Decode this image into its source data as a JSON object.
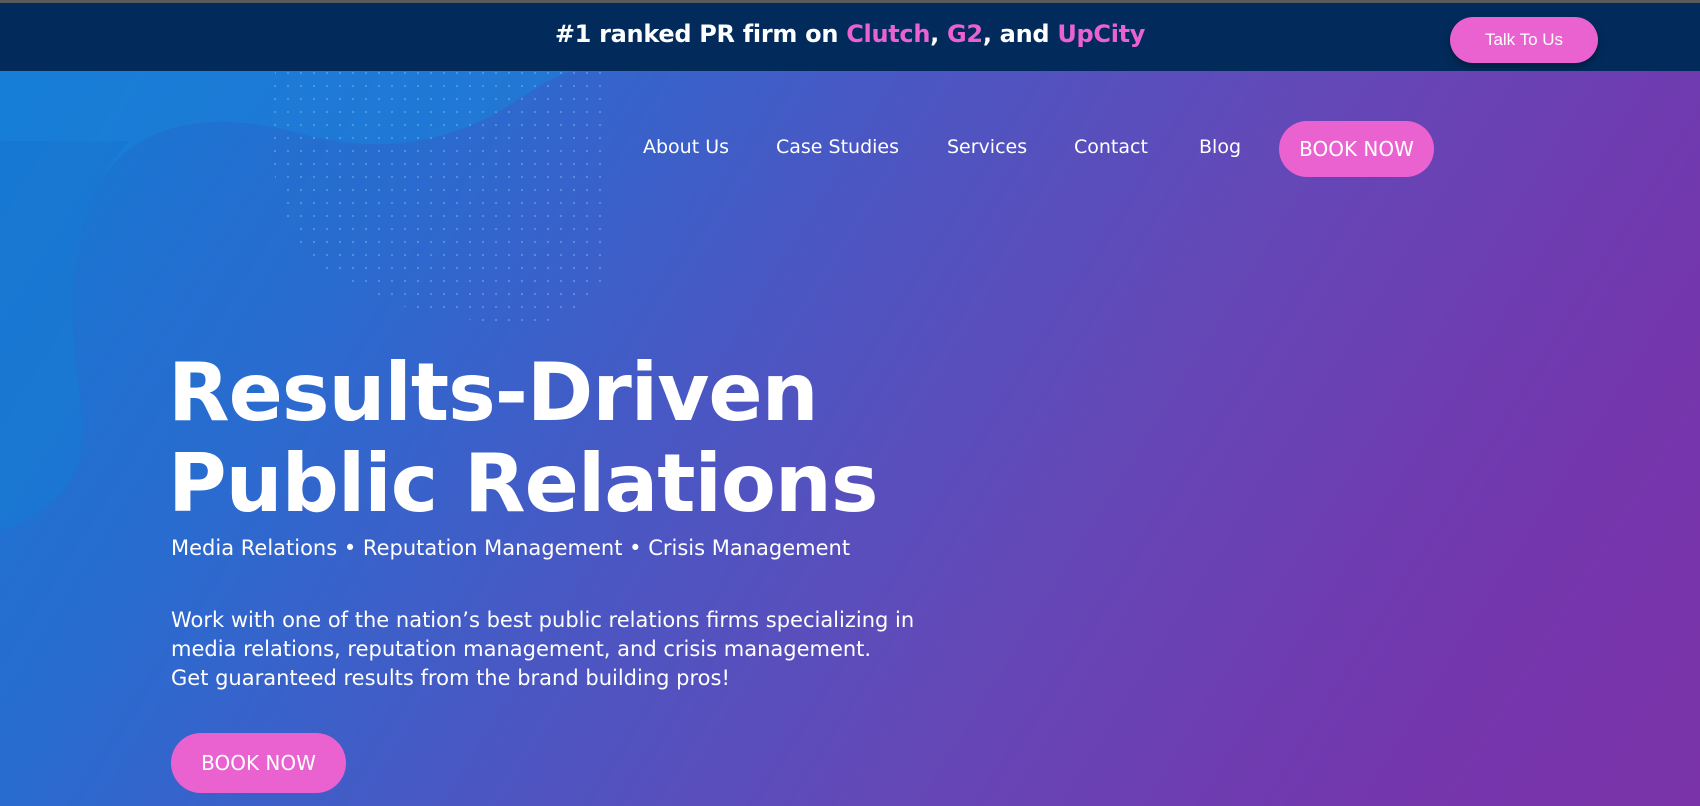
{
  "topbar": {
    "prefix": "#1 ranked PR firm on ",
    "brand1": "Clutch",
    "sep1": ", ",
    "brand2": "G2",
    "sep2": ", and ",
    "brand3": "UpCity",
    "cta_label": "Talk To Us"
  },
  "nav": {
    "items": [
      "About Us",
      "Case Studies",
      "Services",
      "Contact",
      "Blog"
    ],
    "book_label": "BOOK NOW"
  },
  "hero": {
    "headline_line1": "Results-Driven",
    "headline_line2": "Public Relations",
    "subheadline": "Media Relations • Reputation Management • Crisis Management",
    "body_line1": "Work with one of the nation’s best public relations firms specializing in",
    "body_line2": "media relations, reputation management, and crisis management.",
    "body_line3": "Get guaranteed results from the brand building pros!",
    "book_label": "BOOK NOW"
  },
  "colors": {
    "topbar_bg": "#022b5c",
    "accent_pink": "#ea62cf",
    "gradient_start": "#1479d2",
    "gradient_end": "#7b33a9",
    "text": "#ffffff"
  }
}
